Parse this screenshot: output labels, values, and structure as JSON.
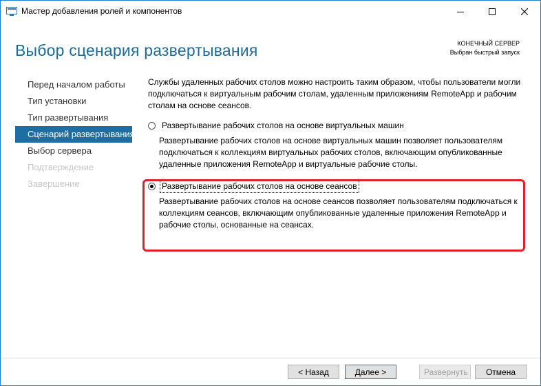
{
  "window": {
    "title": "Мастер добавления ролей и компонентов"
  },
  "header": {
    "page_title": "Выбор сценария развертывания",
    "destination_label": "КОНЕЧНЫЙ СЕРВЕР",
    "destination_value": "Выбран быстрый запуск"
  },
  "nav": {
    "items": [
      {
        "label": "Перед началом работы",
        "state": "normal"
      },
      {
        "label": "Тип установки",
        "state": "normal"
      },
      {
        "label": "Тип развертывания",
        "state": "normal"
      },
      {
        "label": "Сценарий развертывания",
        "state": "active"
      },
      {
        "label": "Выбор сервера",
        "state": "normal"
      },
      {
        "label": "Подтверждение",
        "state": "disabled"
      },
      {
        "label": "Завершение",
        "state": "disabled"
      }
    ]
  },
  "main": {
    "intro": "Службы удаленных рабочих столов можно настроить таким образом, чтобы пользователи могли подключаться к виртуальным рабочим столам, удаленным приложениям RemoteApp и рабочим столам на основе сеансов.",
    "options": [
      {
        "label": "Развертывание рабочих столов на основе виртуальных машин",
        "description": "Развертывание рабочих столов на основе виртуальных машин позволяет пользователям подключаться к коллекциям виртуальных рабочих столов, включающим опубликованные удаленные приложения RemoteApp и виртуальные рабочие столы.",
        "selected": false
      },
      {
        "label": "Развертывание рабочих столов на основе сеансов",
        "description": "Развертывание рабочих столов на основе сеансов позволяет пользователям подключаться к коллекциям сеансов, включающим опубликованные удаленные приложения RemoteApp и рабочие столы, основанные на сеансах.",
        "selected": true
      }
    ]
  },
  "footer": {
    "back_label": "< Назад",
    "next_label": "Далее >",
    "install_label": "Развернуть",
    "cancel_label": "Отмена"
  },
  "colors": {
    "accent": "#1e6ea6",
    "title": "#1e6a9a",
    "highlight": "#e0202a"
  }
}
